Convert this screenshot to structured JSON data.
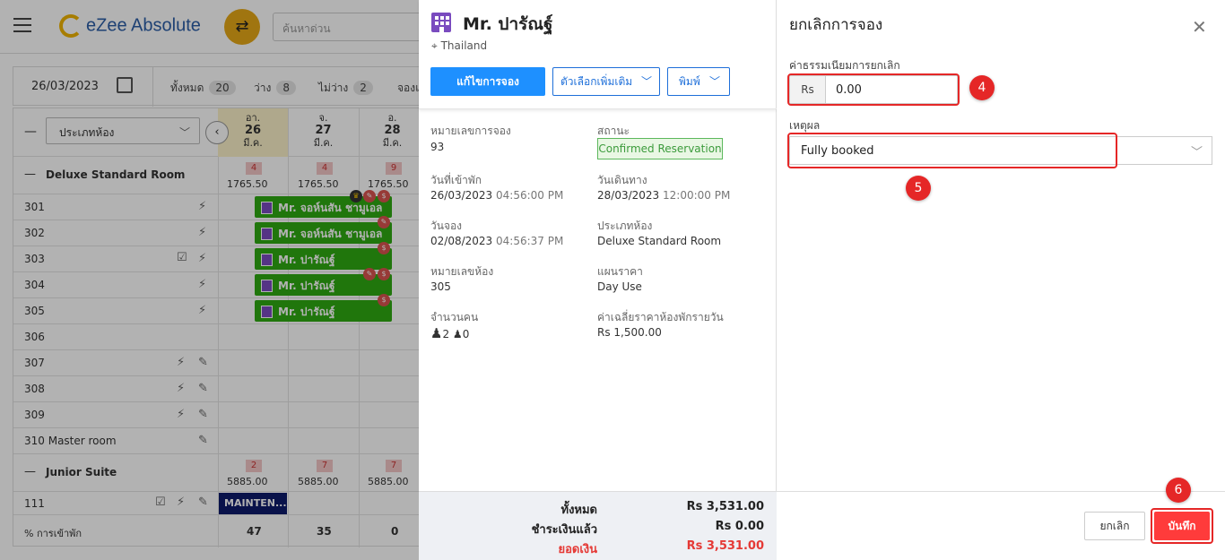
{
  "app": {
    "name": "eZee Absolute",
    "search_placeholder": "ค้นหาด่วน"
  },
  "grid": {
    "date": "26/03/2023",
    "stats": [
      {
        "label": "ทั้งหมด",
        "count": "20"
      },
      {
        "label": "ว่าง",
        "count": "8"
      },
      {
        "label": "ไม่ว่าง",
        "count": "2"
      },
      {
        "label": "จองแ",
        "count": ""
      }
    ],
    "roomtype_select": "ประเภทห้อง",
    "days": [
      {
        "dow": "อา.",
        "day": "26",
        "mon": "มี.ค."
      },
      {
        "dow": "จ.",
        "day": "27",
        "mon": "มี.ค."
      },
      {
        "dow": "อ.",
        "day": "28",
        "mon": "มี.ค."
      }
    ],
    "groups": [
      {
        "name": "Deluxe Standard Room",
        "avail": [
          "4",
          "4",
          "9"
        ],
        "rates": [
          "1765.50",
          "1765.50",
          "1765.50"
        ]
      },
      {
        "name": "Junior Suite",
        "avail": [
          "2",
          "7",
          "7"
        ],
        "rates": [
          "5885.00",
          "5885.00",
          "5885.00"
        ]
      }
    ],
    "rooms": [
      "301",
      "302",
      "303",
      "304",
      "305",
      "306",
      "307",
      "308",
      "309",
      "310 Master room",
      "111"
    ],
    "bookings": [
      "Mr. จอห์นสัน ชามูเอล",
      "Mr. จอห์นสัน ชามูเอล",
      "Mr. ปารัณฐ์",
      "Mr. ปารัณฐ์",
      "Mr. ปารัณฐ์"
    ],
    "maintenance": "MAINTEN...",
    "occupancy_label": "% การเข้าพัก",
    "occupancy": [
      "47",
      "35",
      "0"
    ]
  },
  "detail": {
    "guest_name": "Mr. ปารัณฐ์",
    "country": "Thailand",
    "edit_button": "แก้ไขการจอง",
    "more_button": "ตัวเลือกเพิ่มเติม",
    "print_button": "พิมพ์",
    "fields": {
      "res_no_label": "หมายเลขการจอง",
      "res_no": "93",
      "status_label": "สถานะ",
      "status": "Confirmed Reservation",
      "checkin_label": "วันที่เข้าพัก",
      "checkin_date": "26/03/2023",
      "checkin_time": "04:56:00 PM",
      "checkout_label": "วันเดินทาง",
      "checkout_date": "28/03/2023",
      "checkout_time": "12:00:00 PM",
      "booked_label": "วันจอง",
      "booked_date": "02/08/2023",
      "booked_time": "04:56:37 PM",
      "roomtype_label": "ประเภทห้อง",
      "roomtype": "Deluxe Standard Room",
      "roomno_label": "หมายเลขห้อง",
      "roomno": "305",
      "rateplan_label": "แผนราคา",
      "rateplan": "Day Use",
      "pax_label": "จำนวนคน",
      "adults": "2",
      "children": "0",
      "avgrate_label": "ค่าเฉลี่ยราคาห้องพักรายวัน",
      "avgrate": "Rs 1,500.00"
    },
    "totals": {
      "total_label": "ทั้งหมด",
      "total": "Rs 3,531.00",
      "paid_label": "ชำระเงินแล้ว",
      "paid": "Rs 0.00",
      "balance_label": "ยอดเงิน",
      "balance": "Rs 3,531.00"
    }
  },
  "cancel": {
    "title": "ยกเลิกการจอง",
    "fee_label": "ค่าธรรมเนียมการยกเลิก",
    "currency": "Rs",
    "fee_value": "0.00",
    "reason_label": "เหตุผล",
    "reason_value": "Fully booked",
    "cancel_button": "ยกเลิก",
    "save_button": "บันทึก",
    "steps": [
      "4",
      "5",
      "6"
    ]
  },
  "colors": {
    "accent": "#1e90ff",
    "booking": "#2eaa12",
    "danger": "#ff3b3b",
    "highlight": "#e52727"
  }
}
